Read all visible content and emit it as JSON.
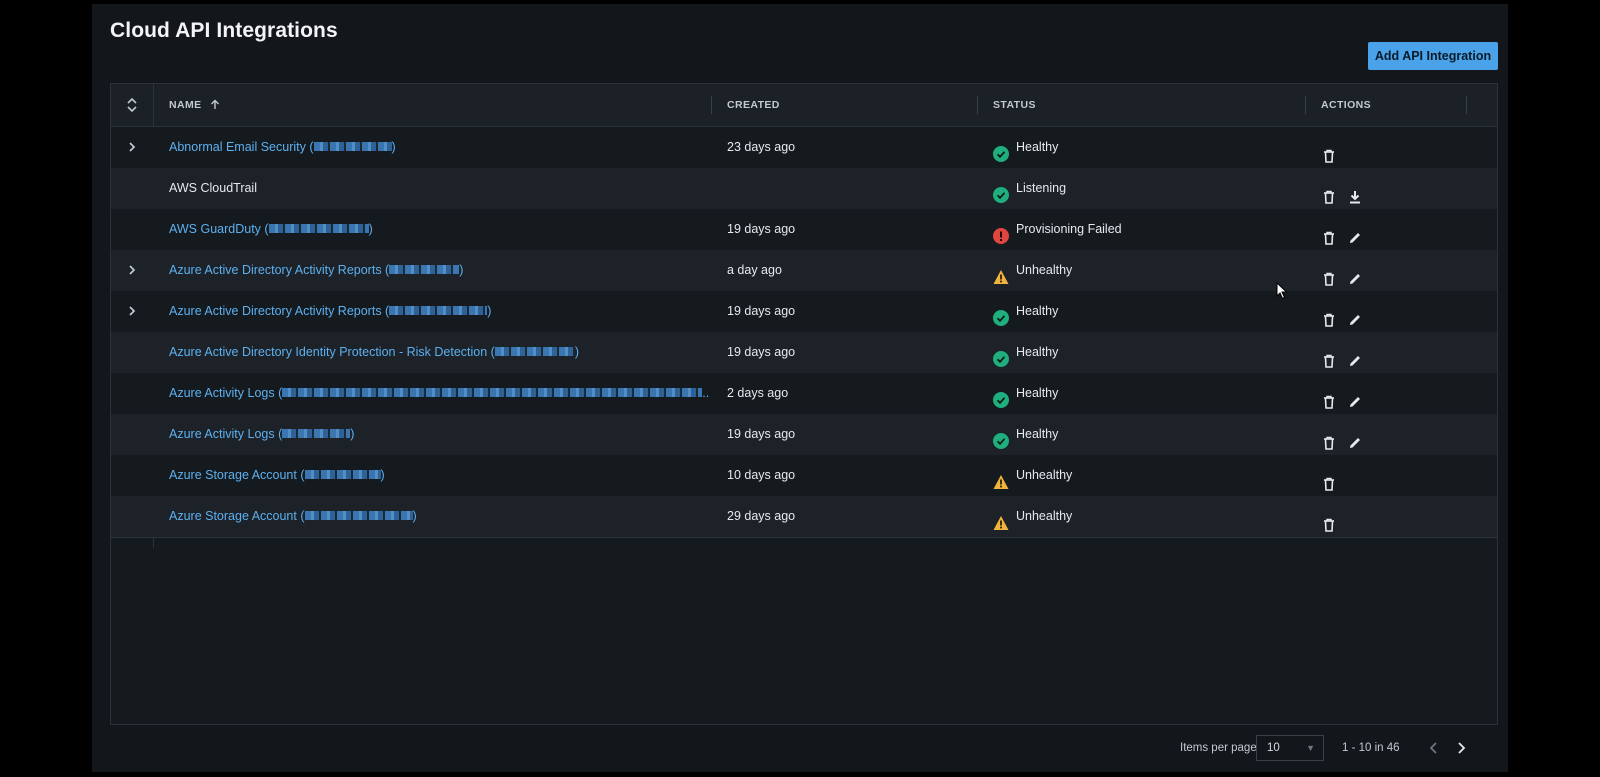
{
  "page": {
    "title": "Cloud API Integrations",
    "add_button_label": "Add API Integration"
  },
  "table": {
    "columns": {
      "name": "NAME",
      "created": "CREATED",
      "status": "STATUS",
      "actions": "ACTIONS"
    },
    "rows": [
      {
        "expandable": true,
        "name": "Abnormal Email Security (",
        "name_suffix": ")",
        "redacted": true,
        "link": true,
        "created": "23 days ago",
        "status": "Healthy",
        "status_kind": "ok",
        "actions": [
          "trash-icon"
        ]
      },
      {
        "expandable": false,
        "name": "AWS CloudTrail",
        "name_suffix": "",
        "redacted": false,
        "link": false,
        "created": "",
        "status": "Listening",
        "status_kind": "ok",
        "actions": [
          "trash-icon",
          "download-icon"
        ]
      },
      {
        "expandable": false,
        "name": "AWS GuardDuty (",
        "name_suffix": ")",
        "redacted": true,
        "link": true,
        "created": "19 days ago",
        "status": "Provisioning Failed",
        "status_kind": "error",
        "actions": [
          "trash-icon",
          "pencil-icon"
        ]
      },
      {
        "expandable": true,
        "name": "Azure Active Directory Activity Reports (",
        "name_suffix": ")",
        "redacted": true,
        "link": true,
        "created": "a day ago",
        "status": "Unhealthy",
        "status_kind": "warn",
        "actions": [
          "trash-icon",
          "pencil-icon"
        ]
      },
      {
        "expandable": true,
        "name": "Azure Active Directory Activity Reports (",
        "name_suffix": ")",
        "redacted": true,
        "link": true,
        "created": "19 days ago",
        "status": "Healthy",
        "status_kind": "ok",
        "actions": [
          "trash-icon",
          "pencil-icon"
        ]
      },
      {
        "expandable": false,
        "name": "Azure Active Directory Identity Protection - Risk Detection (",
        "name_suffix": ")",
        "redacted": true,
        "link": true,
        "created": "19 days ago",
        "status": "Healthy",
        "status_kind": "ok",
        "actions": [
          "trash-icon",
          "pencil-icon"
        ]
      },
      {
        "expandable": false,
        "name": "Azure Activity Logs (",
        "name_suffix": "...",
        "redacted": true,
        "link": true,
        "created": "2 days ago",
        "status": "Healthy",
        "status_kind": "ok",
        "actions": [
          "trash-icon",
          "pencil-icon"
        ]
      },
      {
        "expandable": false,
        "name": "Azure Activity Logs (",
        "name_suffix": ")",
        "redacted": true,
        "link": true,
        "created": "19 days ago",
        "status": "Healthy",
        "status_kind": "ok",
        "actions": [
          "trash-icon",
          "pencil-icon"
        ]
      },
      {
        "expandable": false,
        "name": "Azure Storage Account (",
        "name_suffix": ")",
        "redacted": true,
        "link": true,
        "created": "10 days ago",
        "status": "Unhealthy",
        "status_kind": "warn",
        "actions": [
          "trash-icon"
        ]
      },
      {
        "expandable": false,
        "name": "Azure Storage Account (",
        "name_suffix": ")",
        "redacted": true,
        "link": true,
        "created": "29 days ago",
        "status": "Unhealthy",
        "status_kind": "warn",
        "actions": [
          "trash-icon"
        ]
      }
    ]
  },
  "pagination": {
    "items_per_page_label": "Items per page",
    "items_per_page_value": "10",
    "range_text": "1 - 10 in 46"
  },
  "colors": {
    "ok": "#1fae7d",
    "error": "#e0453f",
    "warn": "#f0b43c",
    "link": "#5db0f0",
    "accent": "#4aa3e8"
  }
}
